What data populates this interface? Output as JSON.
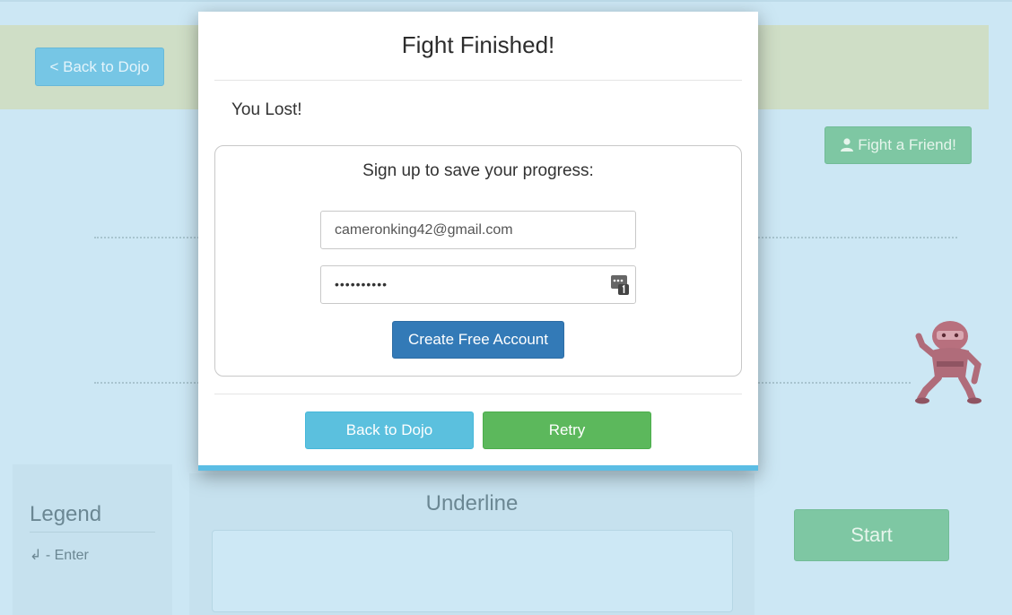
{
  "background": {
    "back_to_dojo_label": "< Back to Dojo",
    "fight_friend_label": "Fight a Friend!",
    "legend": {
      "title": "Legend",
      "items": [
        "↲ - Enter"
      ]
    },
    "exercise_title": "Underline",
    "start_label": "Start"
  },
  "modal": {
    "title": "Fight Finished!",
    "result": "You Lost!",
    "signup": {
      "prompt": "Sign up to save your progress:",
      "email_value": "cameronking42@gmail.com",
      "password_mask": "••••••••••",
      "create_label": "Create Free Account"
    },
    "back_label": "Back to Dojo",
    "retry_label": "Retry"
  },
  "icons": {
    "user": "user-icon",
    "password_manager": "password-manager-icon",
    "ninja": "ninja-opponent-icon"
  },
  "colors": {
    "primary": "#337ab7",
    "info": "#5bc0de",
    "success": "#5cb85c",
    "modal_accent": "#5bbde4",
    "page_bg": "#cce7f4"
  }
}
